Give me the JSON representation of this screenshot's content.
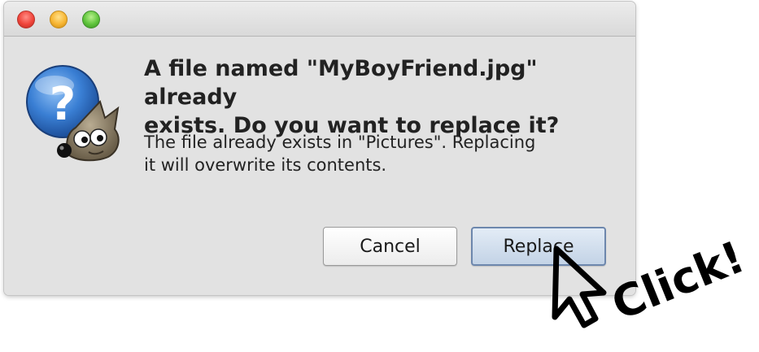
{
  "dialog": {
    "headline": "A file named \"MyBoyFriend.jpg\" already\nexists.  Do you want to replace it?",
    "detail": "The file already exists in \"Pictures\".  Replacing\nit will overwrite its contents.",
    "cancel_label": "Cancel",
    "replace_label": "Replace"
  },
  "annotation": {
    "text": "Click!"
  },
  "colors": {
    "dialog_background": "#e2e2e2",
    "default_button": "#c3d3e6",
    "icon_blue": "#2f6fc4"
  },
  "icons": [
    "close-traffic-light",
    "minimize-traffic-light",
    "zoom-traffic-light",
    "question-wilber-icon",
    "hand-drawn-cursor"
  ]
}
